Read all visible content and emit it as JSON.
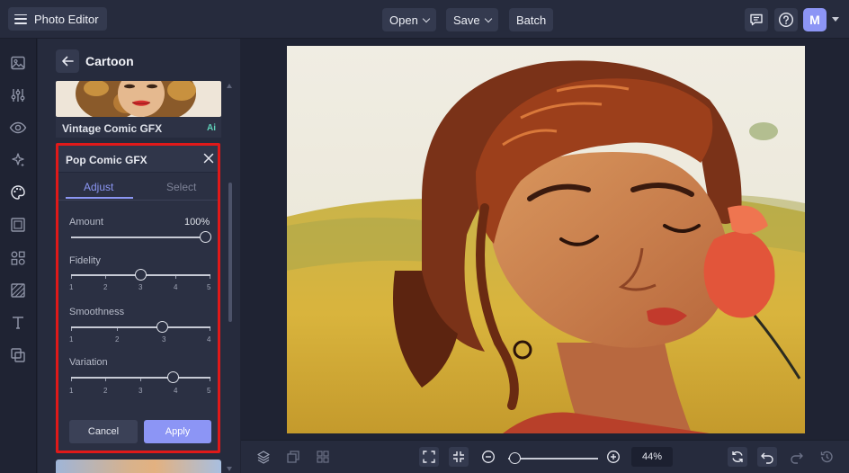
{
  "app": {
    "title": "Photo Editor",
    "user_initial": "M"
  },
  "toolbar": {
    "open_label": "Open",
    "save_label": "Save",
    "batch_label": "Batch"
  },
  "panel": {
    "title": "Cartoon",
    "effect_above": {
      "name": "Vintage Comic GFX",
      "badge": "Ai"
    },
    "card": {
      "title": "Pop Comic GFX",
      "tabs": [
        "Adjust",
        "Select"
      ],
      "active_tab": "Adjust",
      "sliders": {
        "amount": {
          "label": "Amount",
          "value_text": "100%",
          "value": 100,
          "max": 100
        },
        "fidelity": {
          "label": "Fidelity",
          "ticks": [
            "1",
            "2",
            "3",
            "4",
            "5"
          ],
          "value": 3
        },
        "smoothness": {
          "label": "Smoothness",
          "ticks": [
            "1",
            "2",
            "3",
            "4"
          ],
          "value": 3
        },
        "variation": {
          "label": "Variation",
          "ticks": [
            "1",
            "2",
            "3",
            "4",
            "5"
          ],
          "value": 4
        }
      },
      "cancel_label": "Cancel",
      "apply_label": "Apply"
    }
  },
  "canvas": {
    "zoom_text": "44%",
    "zoom_fraction": 0.02
  },
  "colors": {
    "accent": "#8c95f5",
    "highlight_border": "#e01919",
    "ai_badge": "#5fd0b8"
  }
}
